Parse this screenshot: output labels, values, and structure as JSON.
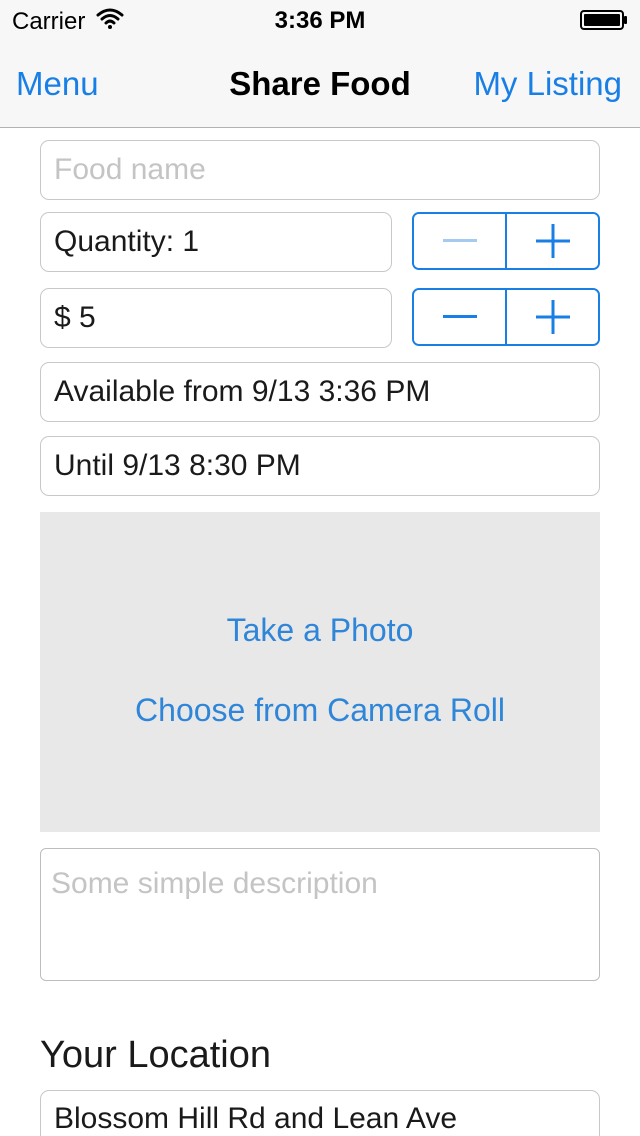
{
  "status_bar": {
    "carrier": "Carrier",
    "time": "3:36 PM"
  },
  "nav": {
    "left_label": "Menu",
    "title": "Share Food",
    "right_label": "My Listing"
  },
  "form": {
    "food_name_placeholder": "Food name",
    "food_name_value": "",
    "quantity_text": "Quantity: 1",
    "price_text": "$ 5",
    "available_from": "Available from 9/13 3:36 PM",
    "until": "Until 9/13 8:30 PM",
    "description_placeholder": "Some simple description"
  },
  "photo": {
    "take_photo": "Take a Photo",
    "choose_roll": "Choose from Camera Roll"
  },
  "location": {
    "heading": "Your Location",
    "value": "Blossom Hill Rd and Lean Ave"
  },
  "colors": {
    "accent": "#1a7fe5",
    "disabled_accent": "#a6c9ef",
    "photo_bg": "#e8e8e8"
  },
  "icons": {
    "wifi": "wifi-icon",
    "battery": "battery-icon",
    "minus": "minus-icon",
    "plus": "plus-icon"
  }
}
